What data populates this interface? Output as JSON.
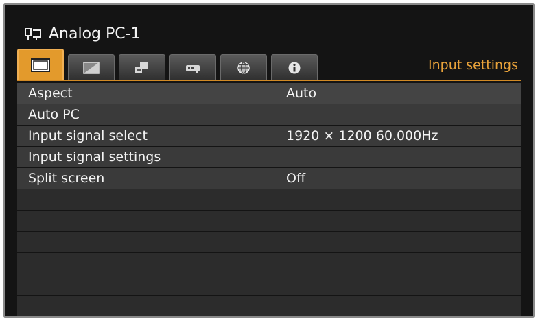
{
  "header": {
    "source_name": "Analog PC-1",
    "section_title": "Input settings"
  },
  "tabs": [
    {
      "icon": "screen-icon",
      "active": true
    },
    {
      "icon": "image-adjust-icon",
      "active": false
    },
    {
      "icon": "installation-icon",
      "active": false
    },
    {
      "icon": "system-icon",
      "active": false
    },
    {
      "icon": "network-icon",
      "active": false
    },
    {
      "icon": "information-icon",
      "active": false
    }
  ],
  "menu": {
    "items": [
      {
        "label": "Aspect",
        "value": "Auto"
      },
      {
        "label": "Auto PC",
        "value": ""
      },
      {
        "label": "Input signal select",
        "value": "1920 × 1200 60.000Hz"
      },
      {
        "label": "Input signal settings",
        "value": ""
      },
      {
        "label": "Split screen",
        "value": "Off"
      }
    ]
  },
  "colors": {
    "accent": "#e39a2c",
    "background": "#141414",
    "row": "#3a3a3a"
  }
}
